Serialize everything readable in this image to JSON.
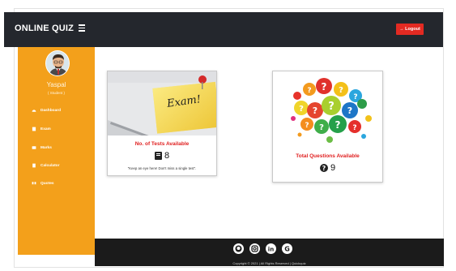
{
  "header": {
    "brand": "ONLINE QUIZ",
    "logout_label": "→ Logout"
  },
  "sidebar": {
    "username": "Yaspal",
    "role": "( Student )",
    "items": [
      {
        "label": "Dashboard",
        "icon": "tachometer-icon"
      },
      {
        "label": "Exam",
        "icon": "book-icon"
      },
      {
        "label": "Marks",
        "icon": "marks-icon"
      },
      {
        "label": "Calculator",
        "icon": "calculator-icon"
      },
      {
        "label": "Quotes",
        "icon": "quote-icon"
      }
    ]
  },
  "cards": [
    {
      "title": "No. of Tests Available",
      "count": "8",
      "icon": "book-icon",
      "quote": "\"Keep an eye here! Don't miss a single test\".",
      "note_text": "Exam!"
    },
    {
      "title": "Total Questions Available",
      "count": "9",
      "icon": "question-circle-icon"
    }
  ],
  "footer": {
    "social": [
      "github-icon",
      "instagram-icon",
      "linkedin-icon",
      "google-icon"
    ],
    "copyright": "Copyright © 2021 | All Rights Reserved | Quickquiz"
  },
  "colors": {
    "topbar": "#24272d",
    "sidebar": "#f3a01b",
    "logout": "#e32a22",
    "card_title": "#e02020",
    "footer": "#1b1b1b"
  }
}
